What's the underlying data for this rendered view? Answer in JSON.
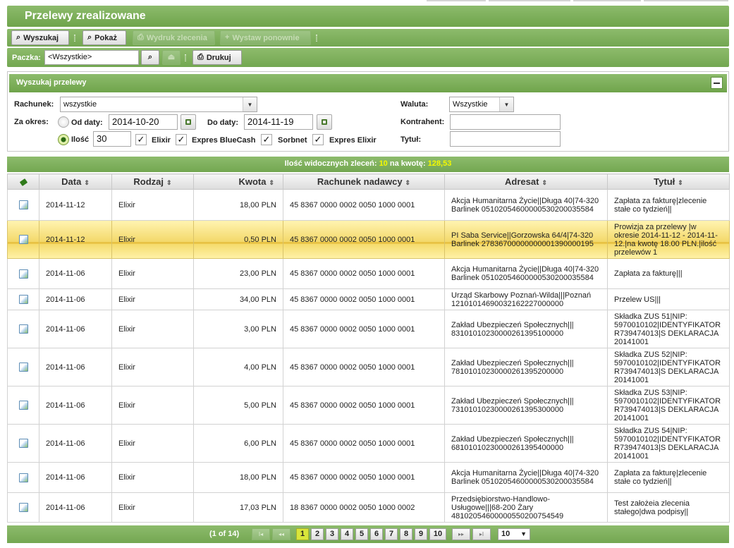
{
  "page_title": "Przelewy zrealizowane",
  "toolbar": {
    "wyszukaj": "Wyszukaj",
    "pokaz": "Pokaż",
    "wydruk": "Wydruk zlecenia",
    "wystaw": "Wystaw ponownie"
  },
  "paczka": {
    "label": "Paczka:",
    "value": "<Wszystkie>",
    "drukuj": "Drukuj"
  },
  "search": {
    "header": "Wyszukaj przelewy",
    "rachunek_label": "Rachunek:",
    "rachunek_value": "wszystkie",
    "za_okres_label": "Za okres:",
    "od_daty_label": "Od daty:",
    "od_daty_value": "2014-10-20",
    "do_daty_label": "Do daty:",
    "do_daty_value": "2014-11-19",
    "ilosc_label": "Ilość",
    "ilosc_value": "30",
    "elixir": "Elixir",
    "expres_bluecash": "Expres BlueCash",
    "sorbnet": "Sorbnet",
    "expres_elixir": "Expres Elixir",
    "waluta_label": "Waluta:",
    "waluta_value": "Wszystkie",
    "kontrahent_label": "Kontrahent:",
    "tytul_label": "Tytuł:"
  },
  "info": {
    "count_label": "Ilość widocznych zleceń:",
    "count": "10",
    "amount_label": "na kwotę:",
    "amount": "128,53"
  },
  "table": {
    "headers": [
      "Data",
      "Rodzaj",
      "Kwota",
      "Rachunek nadawcy",
      "Adresat",
      "Tytuł"
    ],
    "rows": [
      {
        "data": "2014-11-12",
        "rodzaj": "Elixir",
        "kwota": "18,00 PLN",
        "rachunek": "45 8367 0000 0002 0050 1000 0001",
        "adresat": "Akcja Humanitarna Życie||Długa 40|74-320 Barlinek 05102054600000530200035584",
        "tytul": "Zapłata za fakturę|zlecenie stałe co tydzień||"
      },
      {
        "data": "2014-11-12",
        "rodzaj": "Elixir",
        "kwota": "0,50 PLN",
        "rachunek": "45 8367 0000 0002 0050 1000 0001",
        "adresat": "PI Saba Service||Gorzowska 64/4|74-320 Barlinek 27836700000000001390000195",
        "tytul": "Prowizja za przelewy |w okresie 2014-11-12 - 2014-11-12.|na kwotę 18.00 PLN.|ilość przelewów 1"
      },
      {
        "data": "2014-11-06",
        "rodzaj": "Elixir",
        "kwota": "23,00 PLN",
        "rachunek": "45 8367 0000 0002 0050 1000 0001",
        "adresat": "Akcja Humanitarna Życie||Długa 40|74-320 Barlinek 05102054600000530200035584",
        "tytul": "Zapłata za fakturę|||"
      },
      {
        "data": "2014-11-06",
        "rodzaj": "Elixir",
        "kwota": "34,00 PLN",
        "rachunek": "45 8367 0000 0002 0050 1000 0001",
        "adresat": "Urząd Skarbowy Poznań-Wilda|||Poznań 12101014690032162227000000",
        "tytul": "Przelew US|||"
      },
      {
        "data": "2014-11-06",
        "rodzaj": "Elixir",
        "kwota": "3,00 PLN",
        "rachunek": "45 8367 0000 0002 0050 1000 0001",
        "adresat": "Zakład Ubezpieczeń Społecznych||| 83101010230000261395100000",
        "tytul": "Składka ZUS 51|NIP: 5970010102|IDENTYFIKATOR R739474013|S DEKLARACJA 20141001"
      },
      {
        "data": "2014-11-06",
        "rodzaj": "Elixir",
        "kwota": "4,00 PLN",
        "rachunek": "45 8367 0000 0002 0050 1000 0001",
        "adresat": "Zakład Ubezpieczeń Społecznych||| 78101010230000261395200000",
        "tytul": "Składka ZUS 52|NIP: 5970010102|IDENTYFIKATOR R739474013|S DEKLARACJA 20141001"
      },
      {
        "data": "2014-11-06",
        "rodzaj": "Elixir",
        "kwota": "5,00 PLN",
        "rachunek": "45 8367 0000 0002 0050 1000 0001",
        "adresat": "Zakład Ubezpieczeń Społecznych||| 73101010230000261395300000",
        "tytul": "Składka ZUS 53|NIP: 5970010102|IDENTYFIKATOR R739474013|S DEKLARACJA 20141001"
      },
      {
        "data": "2014-11-06",
        "rodzaj": "Elixir",
        "kwota": "6,00 PLN",
        "rachunek": "45 8367 0000 0002 0050 1000 0001",
        "adresat": "Zakład Ubezpieczeń Społecznych||| 68101010230000261395400000",
        "tytul": "Składka ZUS 54|NIP: 5970010102|IDENTYFIKATOR R739474013|S DEKLARACJA 20141001"
      },
      {
        "data": "2014-11-06",
        "rodzaj": "Elixir",
        "kwota": "18,00 PLN",
        "rachunek": "45 8367 0000 0002 0050 1000 0001",
        "adresat": "Akcja Humanitarna Życie||Długa 40|74-320 Barlinek 05102054600000530200035584",
        "tytul": "Zapłata za fakturę|zlecenie stałe co tydzień||"
      },
      {
        "data": "2014-11-06",
        "rodzaj": "Elixir",
        "kwota": "17,03 PLN",
        "rachunek": "18 8367 0000 0002 0050 1000 0002",
        "adresat": "Przedsiębiorstwo-Handlowo-Usługowe|||68-200 Żary 48102054600000550200754549",
        "tytul": "Test założeia zlecenia stałego|dwa podpisy||"
      }
    ]
  },
  "pager": {
    "info": "(1 of 14)",
    "first": "I◂",
    "prev": "◂◂",
    "pages": [
      "1",
      "2",
      "3",
      "4",
      "5",
      "6",
      "7",
      "8",
      "9",
      "10"
    ],
    "next": "▸▸",
    "last": "▸I",
    "rows_per_page": "10"
  },
  "colors": {
    "accent_green": "#7caf5a",
    "highlight_yellow": "#f3d86a",
    "counter_yellow": "#f3f900"
  }
}
